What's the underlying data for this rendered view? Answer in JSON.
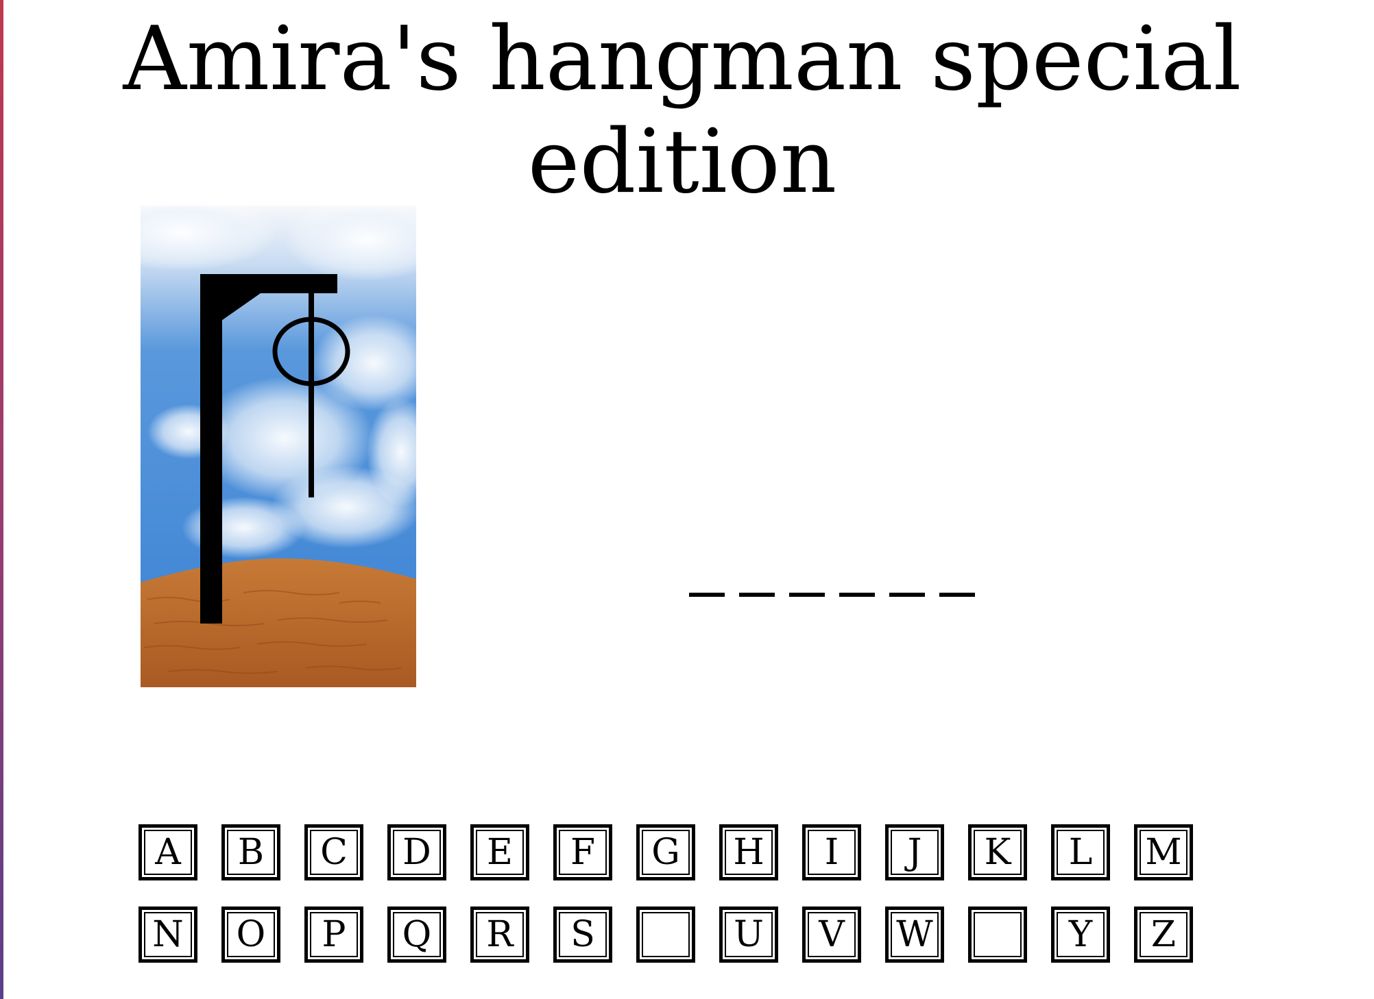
{
  "title": "Amira's hangman special edition",
  "word": {
    "letters": [
      "",
      "",
      "",
      "",
      "",
      ""
    ]
  },
  "keyboard": {
    "rows": [
      [
        {
          "letter": "A",
          "used": false
        },
        {
          "letter": "B",
          "used": false
        },
        {
          "letter": "C",
          "used": false
        },
        {
          "letter": "D",
          "used": false
        },
        {
          "letter": "E",
          "used": false
        },
        {
          "letter": "F",
          "used": false
        },
        {
          "letter": "G",
          "used": false
        },
        {
          "letter": "H",
          "used": false
        },
        {
          "letter": "I",
          "used": false
        },
        {
          "letter": "J",
          "used": false
        },
        {
          "letter": "K",
          "used": false
        },
        {
          "letter": "L",
          "used": false
        },
        {
          "letter": "M",
          "used": false
        }
      ],
      [
        {
          "letter": "N",
          "used": false
        },
        {
          "letter": "O",
          "used": false
        },
        {
          "letter": "P",
          "used": false
        },
        {
          "letter": "Q",
          "used": false
        },
        {
          "letter": "R",
          "used": false
        },
        {
          "letter": "S",
          "used": false
        },
        {
          "letter": "",
          "used": true
        },
        {
          "letter": "U",
          "used": false
        },
        {
          "letter": "V",
          "used": false
        },
        {
          "letter": "W",
          "used": false
        },
        {
          "letter": "",
          "used": true
        },
        {
          "letter": "Y",
          "used": false
        },
        {
          "letter": "Z",
          "used": false
        }
      ]
    ]
  },
  "colors": {
    "sky_top": "#f4f6fa",
    "sky": "#3f86d6",
    "ground": "#b8682c",
    "gallows": "#000000"
  }
}
